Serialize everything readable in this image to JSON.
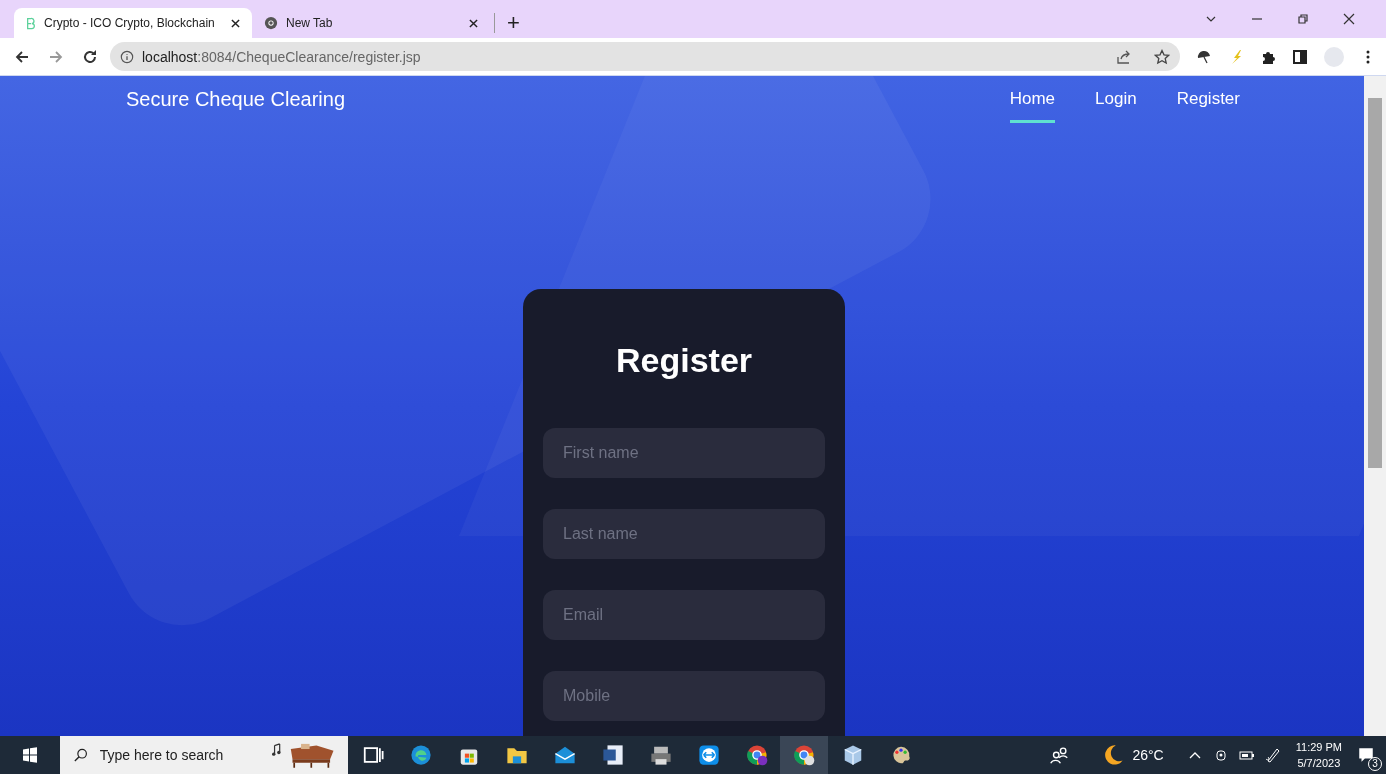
{
  "browser": {
    "tabs": [
      {
        "title": "Crypto - ICO Crypto, Blockchain",
        "selected": true
      },
      {
        "title": "New Tab",
        "selected": false
      }
    ],
    "new_tab": "+",
    "address": {
      "host": "localhost",
      "path": ":8084/ChequeClearance/register.jsp"
    }
  },
  "site": {
    "brand": "Secure Cheque Clearing",
    "nav": [
      {
        "label": "Home",
        "selected": true
      },
      {
        "label": "Login",
        "selected": false
      },
      {
        "label": "Register",
        "selected": false
      }
    ]
  },
  "form": {
    "title": "Register",
    "fields": [
      {
        "placeholder": "First name"
      },
      {
        "placeholder": "Last name"
      },
      {
        "placeholder": "Email"
      },
      {
        "placeholder": "Mobile"
      }
    ]
  },
  "taskbar": {
    "search": {
      "placeholder": "Type here to search"
    },
    "weather": "26°C",
    "time": "11:29 PM",
    "date": "5/7/2023",
    "notifications": "3"
  }
}
